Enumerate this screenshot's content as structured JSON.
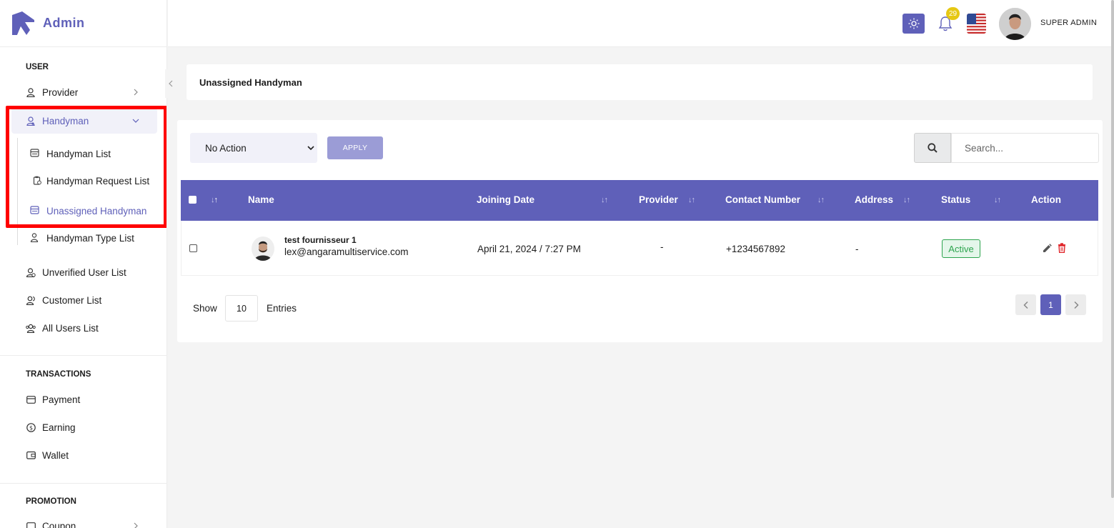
{
  "brand": {
    "name": "Admin"
  },
  "sidebar": {
    "sections": [
      {
        "title": "USER"
      },
      {
        "title": "TRANSACTIONS"
      },
      {
        "title": "PROMOTION"
      }
    ],
    "user_items": [
      {
        "label": "Provider",
        "icon": "user-icon"
      },
      {
        "label": "Handyman",
        "icon": "handyman-icon"
      }
    ],
    "handyman_sub": [
      {
        "label": "Handyman List",
        "icon": "list-icon"
      },
      {
        "label": "Handyman Request List",
        "icon": "clipboard-icon"
      },
      {
        "label": "Unassigned Handyman",
        "icon": "list-icon"
      },
      {
        "label": "Handyman Type List",
        "icon": "user-tag-icon"
      }
    ],
    "more_user_items": [
      {
        "label": "Unverified User List",
        "icon": "user-check-icon"
      },
      {
        "label": "Customer List",
        "icon": "users-icon"
      },
      {
        "label": "All Users List",
        "icon": "users-group-icon"
      }
    ],
    "transaction_items": [
      {
        "label": "Payment",
        "icon": "credit-card-icon"
      },
      {
        "label": "Earning",
        "icon": "dollar-icon"
      },
      {
        "label": "Wallet",
        "icon": "wallet-icon"
      }
    ],
    "promotion_items": [
      {
        "label": "Coupon",
        "icon": "coupon-icon"
      }
    ]
  },
  "header": {
    "notification_count": "29",
    "user_name": "SUPER ADMIN"
  },
  "page": {
    "title": "Unassigned Handyman"
  },
  "toolbar": {
    "action_value": "No Action",
    "apply_label": "APPLY",
    "search_placeholder": "Search..."
  },
  "table": {
    "columns": [
      "Name",
      "Joining Date",
      "Provider",
      "Contact Number",
      "Address",
      "Status",
      "Action"
    ],
    "rows": [
      {
        "name": "test fournisseur 1",
        "email": "lex@angaramultiservice.com",
        "joining_date": "April 21, 2024 / 7:27 PM",
        "provider": "-",
        "contact": "+1234567892",
        "address": "-",
        "status": "Active"
      }
    ]
  },
  "pagination": {
    "show_label": "Show",
    "page_size": "10",
    "entries_label": "Entries",
    "current_page": "1"
  },
  "colors": {
    "accent": "#5f60b9",
    "status_active": "#2da44e",
    "delete": "#e0262b",
    "highlight": "#ff0000"
  }
}
